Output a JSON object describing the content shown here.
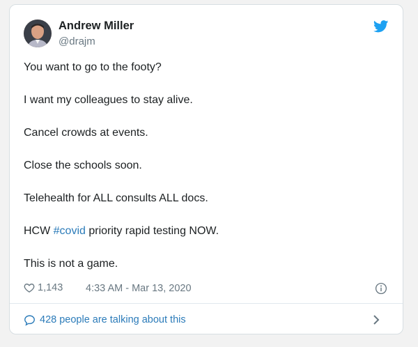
{
  "author": {
    "name": "Andrew Miller",
    "handle": "@drajm"
  },
  "tweet": {
    "paragraphs": [
      "You want to go to the footy?",
      "I want my colleagues to stay alive.",
      "Cancel crowds at events.",
      "Close the schools soon.",
      "Telehealth for ALL consults ALL docs."
    ],
    "hashtag_line": {
      "before": "HCW ",
      "hashtag": "#covid",
      "after": " priority rapid testing NOW."
    },
    "last_paragraph": "This is not a game."
  },
  "meta": {
    "like_count": "1,143",
    "timestamp": "4:33 AM - Mar 13, 2020"
  },
  "conversation": {
    "label": "428 people are talking about this"
  },
  "colors": {
    "link_blue": "#2b7bb9",
    "twitter_blue": "#1da1f2",
    "muted_gray": "#697882"
  },
  "icons": {
    "brand": "twitter-bird-icon",
    "like": "heart-icon",
    "info": "info-icon",
    "conversation": "speech-bubble-icon",
    "chevron": "chevron-right-icon"
  }
}
